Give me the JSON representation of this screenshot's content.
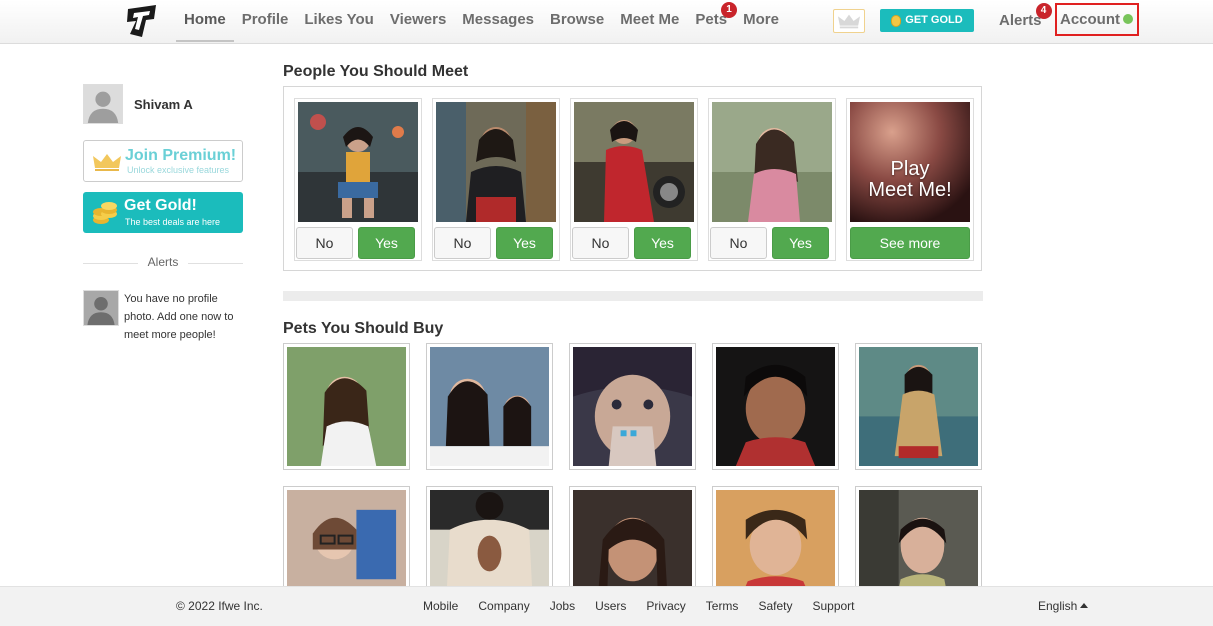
{
  "nav": {
    "items": [
      {
        "label": "Home",
        "active": true
      },
      {
        "label": "Profile"
      },
      {
        "label": "Likes You"
      },
      {
        "label": "Viewers"
      },
      {
        "label": "Messages"
      },
      {
        "label": "Browse"
      },
      {
        "label": "Meet Me"
      },
      {
        "label": "Pets",
        "badge": "1"
      },
      {
        "label": "More"
      }
    ],
    "get_gold_label": "GET GOLD",
    "alerts_label": "Alerts",
    "alerts_badge": "4",
    "account_label": "Account",
    "accent_color": "#1bbcbc",
    "badge_color": "#c9242b"
  },
  "sidebar": {
    "user_name": "Shivam A",
    "premium": {
      "title": "Join Premium!",
      "subtitle": "Unlock exclusive features"
    },
    "gold": {
      "title": "Get Gold!",
      "subtitle": "The best deals are here"
    },
    "alerts_heading": "Alerts",
    "alert_message": "You have no profile photo. Add one now to meet more people!"
  },
  "meet": {
    "heading": "People You Should Meet",
    "no_label": "No",
    "yes_label": "Yes",
    "play_line1": "Play",
    "play_line2": "Meet Me!",
    "see_more_label": "See more"
  },
  "pets": {
    "heading": "Pets You Should Buy"
  },
  "footer": {
    "copyright": "© 2022 Ifwe Inc.",
    "links": [
      "Mobile",
      "Company",
      "Jobs",
      "Users",
      "Privacy",
      "Terms",
      "Safety",
      "Support"
    ],
    "language": "English"
  }
}
